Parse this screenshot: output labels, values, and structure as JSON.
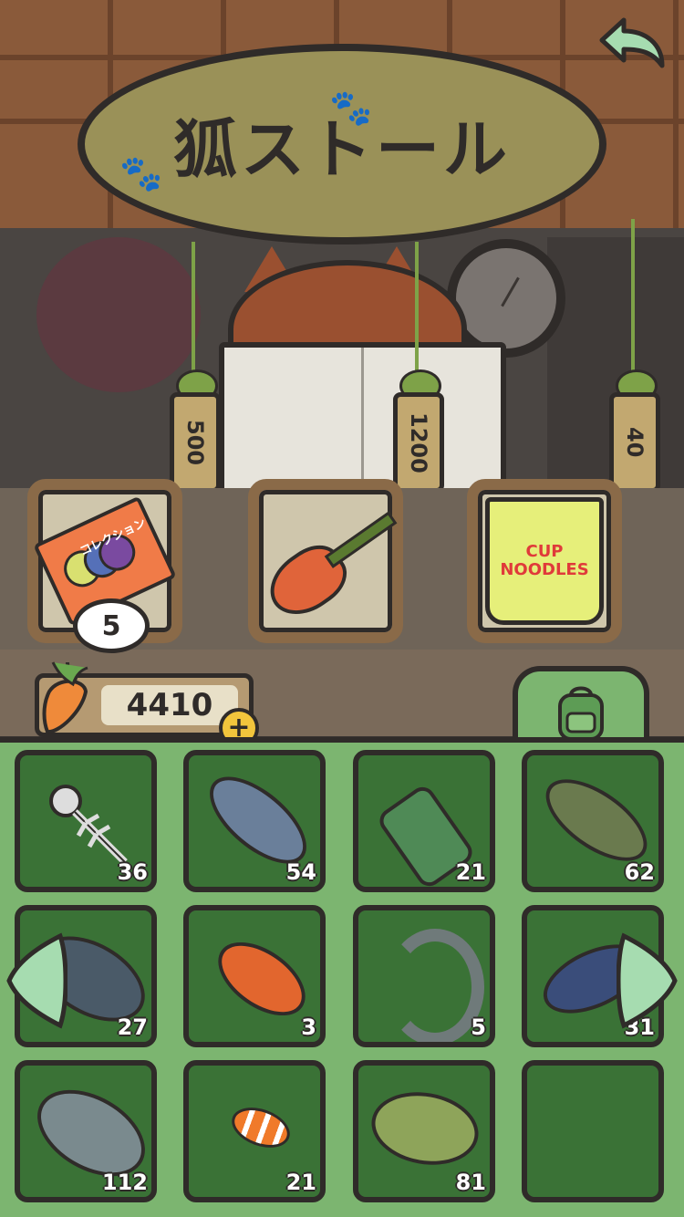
{
  "shop": {
    "sign_title": "狐ストール",
    "tags": [
      "500",
      "1200",
      "40"
    ],
    "items": [
      {
        "name": "collection-ticket",
        "label": "コレクション",
        "stock": "5"
      },
      {
        "name": "carrot-guitar"
      },
      {
        "name": "cup-noodles",
        "label_line1": "CUP",
        "label_line2": "NOODLES"
      }
    ]
  },
  "currency": {
    "amount": "4410",
    "add_symbol": "+"
  },
  "inventory": [
    {
      "item": "fish-bone",
      "count": "36"
    },
    {
      "item": "tuna",
      "count": "54"
    },
    {
      "item": "message-bottle",
      "count": "21"
    },
    {
      "item": "bass",
      "count": "62"
    },
    {
      "item": "carp",
      "count": "27"
    },
    {
      "item": "goldfish",
      "count": "3"
    },
    {
      "item": "sturgeon",
      "count": "5"
    },
    {
      "item": "flying-fish",
      "count": "31"
    },
    {
      "item": "crucian-carp",
      "count": "112"
    },
    {
      "item": "clownfish",
      "count": "21"
    },
    {
      "item": "sunfish",
      "count": "81"
    },
    {
      "item": "empty",
      "count": ""
    }
  ],
  "colors": {
    "panel_green": "#7cb570",
    "slot_green": "#3a7236",
    "outline": "#2f2b29",
    "coin": "#f2c53c"
  }
}
